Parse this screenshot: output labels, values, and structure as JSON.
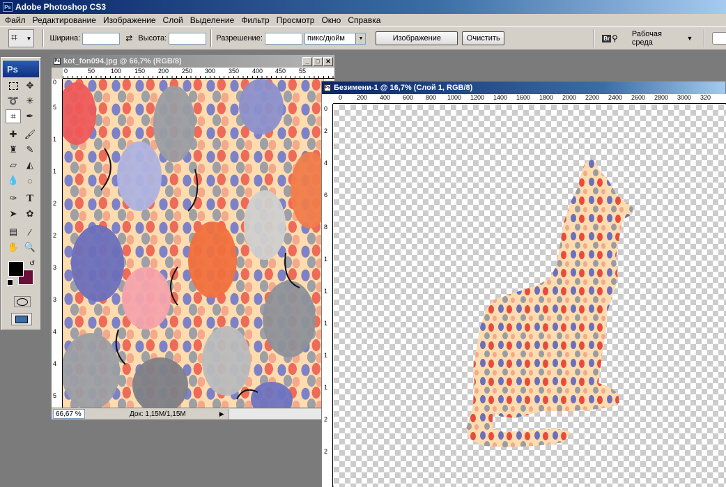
{
  "app": {
    "title": "Adobe Photoshop CS3",
    "icon": "Ps"
  },
  "menu": [
    "Файл",
    "Редактирование",
    "Изображение",
    "Слой",
    "Выделение",
    "Фильтр",
    "Просмотр",
    "Окно",
    "Справка"
  ],
  "options": {
    "width_label": "Ширина:",
    "width_value": "",
    "height_label": "Высота:",
    "height_value": "",
    "resolution_label": "Разрешение:",
    "resolution_value": "",
    "units": "пикс/дюйм",
    "image_button": "Изображение",
    "clear_button": "Очистить",
    "bridge_icon": "Br",
    "workspace_label": "Рабочая среда"
  },
  "toolbox": {
    "logo": "Ps"
  },
  "doc1": {
    "title": "kot_fon094.jpg @ 66,7% (RGB/8)",
    "zoom": "66,67 %",
    "status": "Док: 1,15М/1,15М",
    "ruler_h": [
      "0",
      "50",
      "100",
      "150",
      "200",
      "250",
      "300",
      "350",
      "400",
      "450",
      "55"
    ],
    "ruler_v": [
      "0",
      "5",
      "1",
      "1",
      "2",
      "2",
      "3",
      "3",
      "4",
      "4",
      "5"
    ]
  },
  "doc2": {
    "title": "Безимени-1 @ 16,7% (Слой 1, RGB/8)",
    "ruler_h": [
      "0",
      "200",
      "400",
      "600",
      "800",
      "1000",
      "1200",
      "1400",
      "1600",
      "1800",
      "2000",
      "2200",
      "2400",
      "2600",
      "2800",
      "3000",
      "320"
    ],
    "ruler_v": [
      "0",
      "2",
      "4",
      "6",
      "8",
      "1",
      "1",
      "1",
      "1",
      "1",
      "2",
      "2"
    ]
  },
  "colors": {
    "foreground": "#000000",
    "background": "#6b0f3a"
  }
}
